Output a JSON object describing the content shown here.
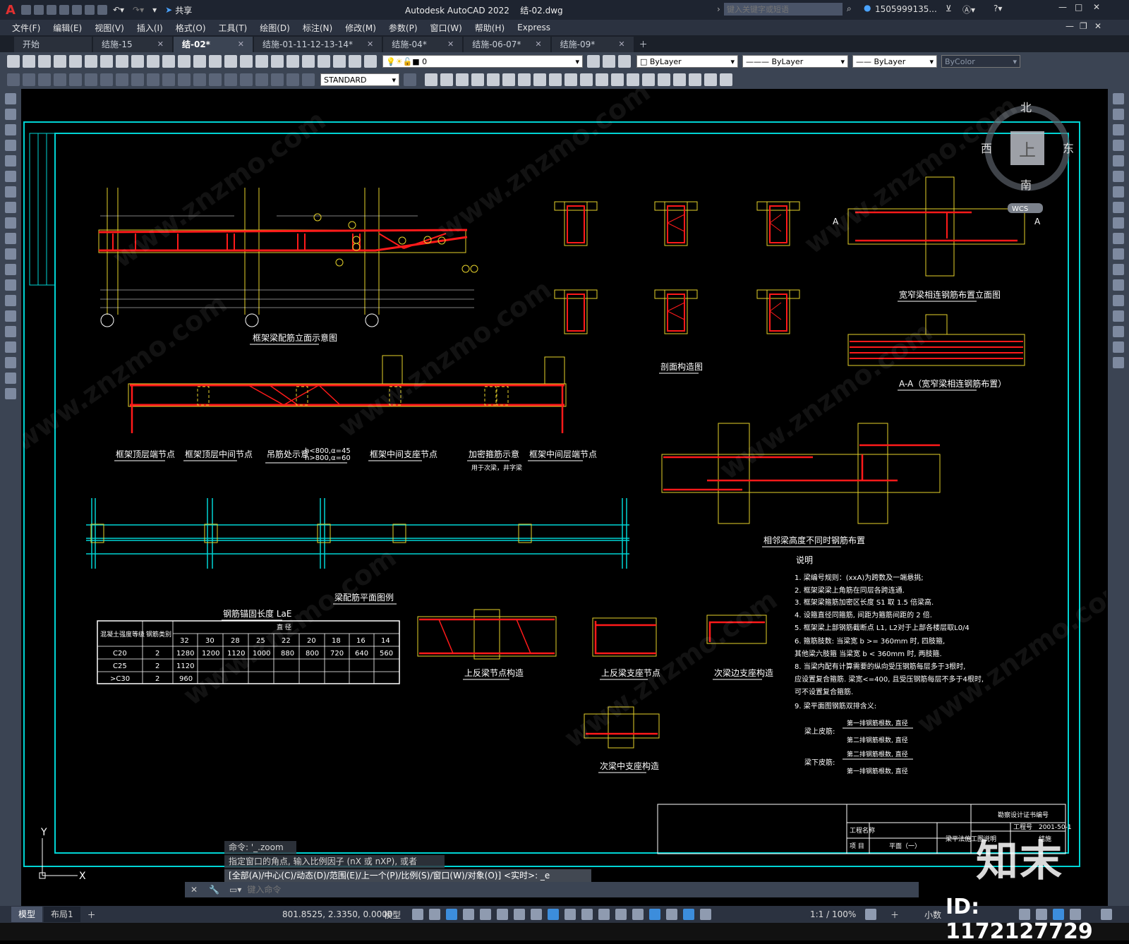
{
  "app": {
    "title": "Autodesk AutoCAD 2022",
    "filename": "结-02.dwg",
    "search_placeholder": "键入关键字或短语",
    "user": "1505999135...",
    "logo": "A"
  },
  "quick_access": {
    "share_label": "共享"
  },
  "menus": [
    "文件(F)",
    "编辑(E)",
    "视图(V)",
    "插入(I)",
    "格式(O)",
    "工具(T)",
    "绘图(D)",
    "标注(N)",
    "修改(M)",
    "参数(P)",
    "窗口(W)",
    "帮助(H)",
    "Express"
  ],
  "tabs": [
    {
      "label": "开始",
      "closable": false,
      "active": false
    },
    {
      "label": "结施-15",
      "closable": true,
      "active": false
    },
    {
      "label": "结-02*",
      "closable": true,
      "active": true
    },
    {
      "label": "结施-01-11-12-13-14*",
      "closable": true,
      "active": false
    },
    {
      "label": "结施-04*",
      "closable": true,
      "active": false
    },
    {
      "label": "结施-06-07*",
      "closable": true,
      "active": false
    },
    {
      "label": "结施-09*",
      "closable": true,
      "active": false
    }
  ],
  "layer_combo": "0",
  "text_style_combo": "STANDARD",
  "color_combo": "ByLayer",
  "linetype_combo": "ByLayer",
  "lineweight_combo": "ByLayer",
  "plotstyle_combo": "ByColor",
  "viewcube": {
    "north": "北",
    "south": "南",
    "east": "东",
    "west": "西",
    "top": "上",
    "wcs": "WCS"
  },
  "drawing": {
    "titles": {
      "frame_elev": "框架梁配筋立面示意图",
      "section": "剖面构造图",
      "wide_narrow": "宽窄梁相连钢筋布置立面图",
      "aa": "A-A（宽窄梁相连钢筋布置）",
      "top_end": "框架顶层端节点",
      "top_mid": "框架顶层中间节点",
      "hanger": "吊筋处示意",
      "hanger_note1": "h<800,α=45",
      "hanger_note2": "h>800,α=60",
      "mid_support": "框架中间支座节点",
      "stirrup": "加密箍筋示意",
      "stirrup_sub": "用于次梁，井字梁",
      "mid_end": "框架中间层端节点",
      "diff_height": "相邻梁高度不同时钢筋布置",
      "plan": "梁配筋平面图例",
      "anchor_table": "钢筋锚固长度 LaE",
      "upturn_joint": "上反梁节点构造",
      "upturn_support": "上反梁支座节点",
      "sec_edge": "次梁边支座构造",
      "sec_mid": "次梁中支座构造"
    },
    "table": {
      "col_concrete": "混凝土强度等级",
      "col_class": "钢筋类别",
      "col_dia": "直 径",
      "diameters": [
        "32",
        "30",
        "28",
        "25",
        "22",
        "20",
        "18",
        "16",
        "14"
      ],
      "rows": [
        {
          "grade": "C20",
          "cls": "2",
          "vals": [
            "1280",
            "1200",
            "1120",
            "1000",
            "880",
            "800",
            "720",
            "640",
            "560"
          ]
        },
        {
          "grade": "C25",
          "cls": "2",
          "vals": [
            "1120",
            "",
            "",
            "",
            "",
            "",
            "",
            "",
            ""
          ]
        },
        {
          "grade": ">C30",
          "cls": "2",
          "vals": [
            "960",
            "",
            "",
            "",
            "",
            "",
            "",
            "",
            ""
          ]
        }
      ]
    },
    "notes_title": "说明",
    "notes": [
      "1. 梁编号规则：(xxA)为跨数及一端悬挑;",
      "2. 框架梁梁上角筋在同层各跨连通.",
      "3. 框架梁箍筋加密区长度 S1 取 1.5 倍梁高.",
      "4. 设箍直径同箍筋, 间距为箍筋间距的 2 倍.",
      "5. 框架梁上部钢筋截断点 L1, L2对于上部各楼层取L0/4",
      "6. 箍筋肢数: 当梁宽 b >= 360mm 时, 四肢箍,",
      "   其他梁六肢箍  当梁宽 b < 360mm 时, 两肢箍.",
      "8. 当梁内配有计算需要的纵向受压钢筋每层多于3根时,",
      "   应设置复合箍筋. 梁宽<=400, 且受压钢筋每层不多于4根时,",
      "   可不设置复合箍筋.",
      "9. 梁平面图钢筋双排含义:"
    ],
    "legend_top": "梁上皮筋:",
    "legend_bottom": "梁下皮筋:",
    "legend_r1": "第一排钢筋根数, 直径",
    "legend_r2": "第二排钢筋根数, 直径",
    "legend_r3": "第二排钢筋根数, 直径",
    "legend_r4": "第一排钢筋根数, 直径",
    "titleblock": {
      "cert": "勘察设计证书编号",
      "project": "工程名称",
      "item": "项 目",
      "sheet": "梁平法施工图说明",
      "no_label": "工程号",
      "no_val": "2001-50-1",
      "drawing_no": "结施",
      "scale": "平面（一）"
    },
    "section_label_a": "A"
  },
  "command_history": [
    "命令: '_.zoom",
    "指定窗口的角点, 输入比例因子 (nX 或 nXP), 或者",
    "[全部(A)/中心(C)/动态(D)/范围(E)/上一个(P)/比例(S)/窗口(W)/对象(O)] <实时>: _e"
  ],
  "command_placeholder": "键入命令",
  "status": {
    "layout_tabs": [
      "模型",
      "布局1"
    ],
    "coords": "801.8525, 2.3350, 0.0000",
    "mode": "模型",
    "scale": "1:1 / 100%",
    "units": "小数"
  },
  "watermark": {
    "text": "www.znzmo.com",
    "logo": "知末",
    "id": "ID: 1172127729"
  },
  "colors": {
    "frame": "#00d4d4",
    "rebar": "#ff1a1a",
    "concrete": "#e6d22a",
    "dim": "#ffffff",
    "accent": "#3c8ddc"
  }
}
